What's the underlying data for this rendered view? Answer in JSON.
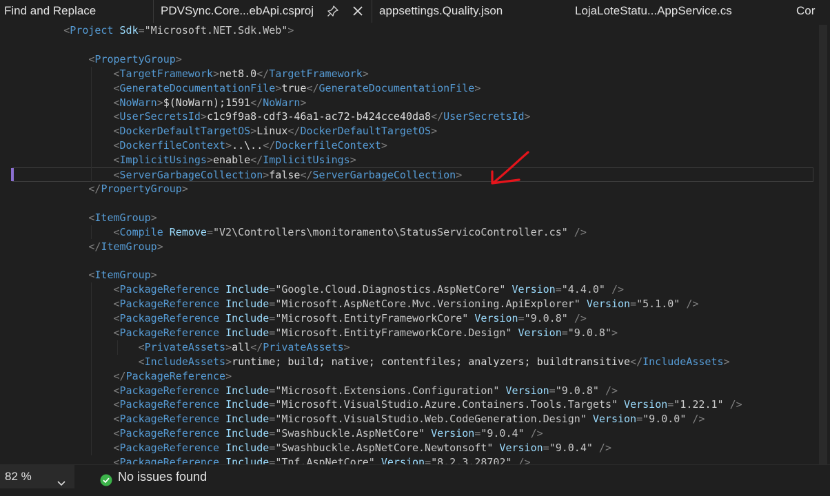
{
  "tabs": [
    {
      "label": "Find and Replace"
    },
    {
      "label": "PDVSync.Core...ebApi.csproj"
    },
    {
      "label": "appsettings.Quality.json"
    },
    {
      "label": "LojaLoteStatu...AppService.cs"
    },
    {
      "label": "Cor"
    }
  ],
  "icons": {
    "pin": "pin-icon",
    "close": "close-icon",
    "chevron": "chevron-down-icon",
    "issues": "check-circle-icon",
    "annotation": "red-arrow"
  },
  "colors": {
    "tag": "#569cd6",
    "attribute": "#9cdcfe",
    "punctuation": "#808080",
    "annotation": "#e5141b",
    "success": "#3cb34a"
  },
  "code": {
    "lines": [
      "<Project Sdk=\"Microsoft.NET.Sdk.Web\">",
      "",
      "<PropertyGroup>",
      "<TargetFramework>net8.0</TargetFramework>",
      "<GenerateDocumentationFile>true</GenerateDocumentationFile>",
      "<NoWarn>$(NoWarn);1591</NoWarn>",
      "<UserSecretsId>c1c9f9a8-cdf3-46a1-ac72-b424cce40da8</UserSecretsId>",
      "<DockerDefaultTargetOS>Linux</DockerDefaultTargetOS>",
      "<DockerfileContext>..\\..</DockerfileContext>",
      "<ImplicitUsings>enable</ImplicitUsings>",
      "<ServerGarbageCollection>false</ServerGarbageCollection>",
      "</PropertyGroup>",
      "",
      "<ItemGroup>",
      "<Compile Remove=\"V2\\Controllers\\monitoramento\\StatusServicoController.cs\" />",
      "</ItemGroup>",
      "",
      "<ItemGroup>",
      "<PackageReference Include=\"Google.Cloud.Diagnostics.AspNetCore\" Version=\"4.4.0\" />",
      "<PackageReference Include=\"Microsoft.AspNetCore.Mvc.Versioning.ApiExplorer\" Version=\"5.1.0\" />",
      "<PackageReference Include=\"Microsoft.EntityFrameworkCore\" Version=\"9.0.8\" />",
      "<PackageReference Include=\"Microsoft.EntityFrameworkCore.Design\" Version=\"9.0.8\">",
      "<PrivateAssets>all</PrivateAssets>",
      "<IncludeAssets>runtime; build; native; contentfiles; analyzers; buildtransitive</IncludeAssets>",
      "</PackageReference>",
      "<PackageReference Include=\"Microsoft.Extensions.Configuration\" Version=\"9.0.8\" />",
      "<PackageReference Include=\"Microsoft.VisualStudio.Azure.Containers.Tools.Targets\" Version=\"1.22.1\" />",
      "<PackageReference Include=\"Microsoft.VisualStudio.Web.CodeGeneration.Design\" Version=\"9.0.0\" />",
      "<PackageReference Include=\"Swashbuckle.AspNetCore\" Version=\"9.0.4\" />",
      "<PackageReference Include=\"Swashbuckle.AspNetCore.Newtonsoft\" Version=\"9.0.4\" />",
      "<PackageReference Include=\"Tnf.AspNetCore\" Version=\"8.2.3.28702\" />"
    ]
  },
  "status": {
    "zoom": "82 %",
    "issues": "No issues found"
  }
}
